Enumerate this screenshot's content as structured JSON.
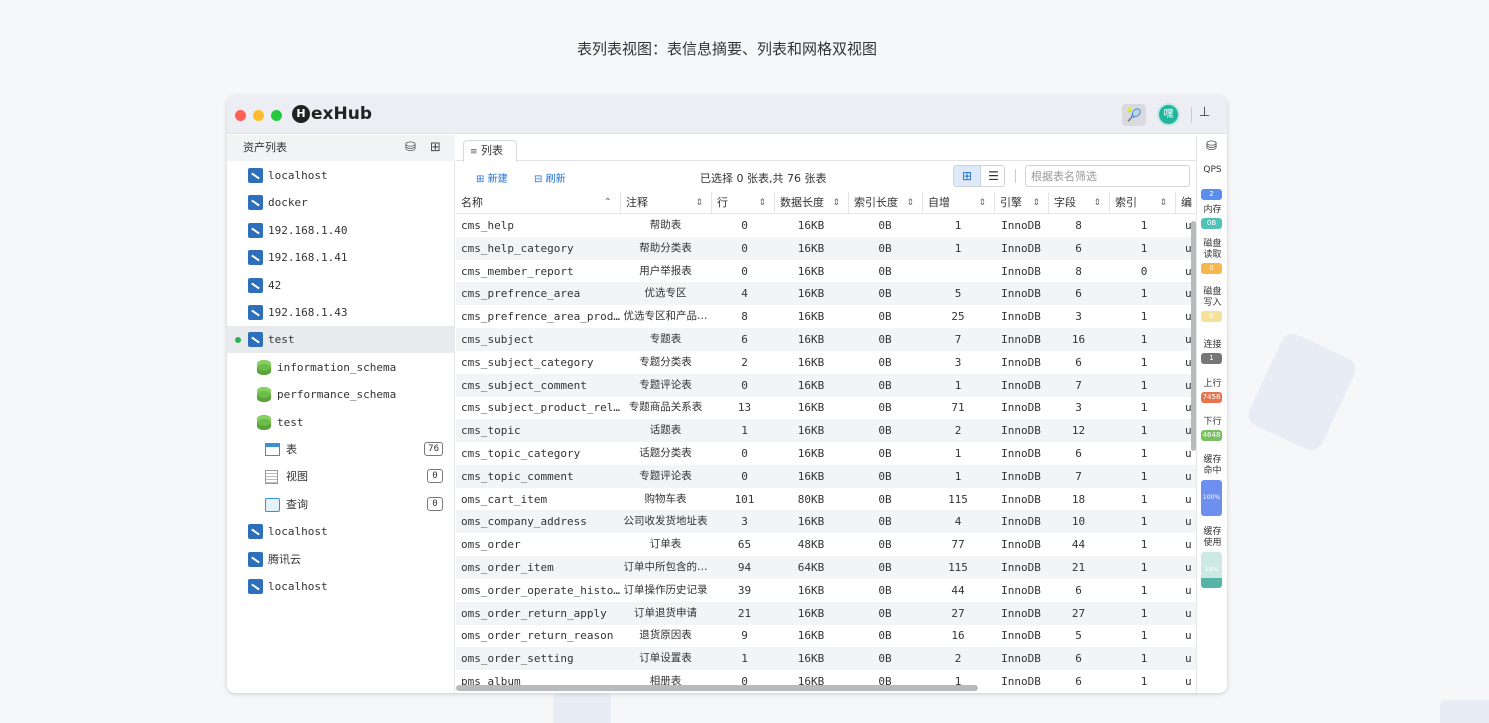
{
  "caption": "表列表视图：表信息摘要、列表和网格双视图",
  "app": {
    "name": "exHub",
    "logo_letter": "H",
    "avatar_text": "嘿",
    "titlebar_icon": "🎾"
  },
  "sidebar": {
    "title": "资产列表",
    "header_icons": [
      "add-db-icon",
      "add-folder-icon"
    ],
    "items": [
      {
        "label": "localhost",
        "type": "server"
      },
      {
        "label": "docker",
        "type": "server"
      },
      {
        "label": "192.168.1.40",
        "type": "server"
      },
      {
        "label": "192.168.1.41",
        "type": "server"
      },
      {
        "label": "42",
        "type": "server"
      },
      {
        "label": "192.168.1.43",
        "type": "server"
      },
      {
        "label": "test",
        "type": "server",
        "active": true,
        "connected": true
      },
      {
        "label": "information_schema",
        "type": "database"
      },
      {
        "label": "performance_schema",
        "type": "database"
      },
      {
        "label": "test",
        "type": "database"
      },
      {
        "label": "表",
        "type": "tables",
        "count": "76"
      },
      {
        "label": "视图",
        "type": "views",
        "count": "0"
      },
      {
        "label": "查询",
        "type": "queries",
        "count": "0"
      },
      {
        "label": "localhost",
        "type": "server"
      },
      {
        "label": "腾讯云",
        "type": "server"
      },
      {
        "label": "localhost",
        "type": "server"
      }
    ]
  },
  "tabs": [
    {
      "label": "列表",
      "icon": "list-icon"
    }
  ],
  "toolbar": {
    "new_label": "新建",
    "refresh_label": "刷新",
    "selection_info": "已选择 0 张表,共 76 张表",
    "filter_placeholder": "根据表名筛选",
    "view_mode": "grid"
  },
  "table": {
    "columns": [
      "名称",
      "注释",
      "行",
      "数据长度",
      "索引长度",
      "自增",
      "引擎",
      "字段",
      "索引",
      "编"
    ],
    "rows": [
      [
        "cms_help",
        "帮助表",
        "0",
        "16KB",
        "0B",
        "1",
        "InnoDB",
        "8",
        "1",
        "u"
      ],
      [
        "cms_help_category",
        "帮助分类表",
        "0",
        "16KB",
        "0B",
        "1",
        "InnoDB",
        "6",
        "1",
        "u"
      ],
      [
        "cms_member_report",
        "用户举报表",
        "0",
        "16KB",
        "0B",
        "",
        "InnoDB",
        "8",
        "0",
        "u"
      ],
      [
        "cms_prefrence_area",
        "优选专区",
        "4",
        "16KB",
        "0B",
        "5",
        "InnoDB",
        "6",
        "1",
        "u"
      ],
      [
        "cms_prefrence_area_prod…",
        "优选专区和产品…",
        "8",
        "16KB",
        "0B",
        "25",
        "InnoDB",
        "3",
        "1",
        "u"
      ],
      [
        "cms_subject",
        "专题表",
        "6",
        "16KB",
        "0B",
        "7",
        "InnoDB",
        "16",
        "1",
        "u"
      ],
      [
        "cms_subject_category",
        "专题分类表",
        "2",
        "16KB",
        "0B",
        "3",
        "InnoDB",
        "6",
        "1",
        "u"
      ],
      [
        "cms_subject_comment",
        "专题评论表",
        "0",
        "16KB",
        "0B",
        "1",
        "InnoDB",
        "7",
        "1",
        "u"
      ],
      [
        "cms_subject_product_rel…",
        "专题商品关系表",
        "13",
        "16KB",
        "0B",
        "71",
        "InnoDB",
        "3",
        "1",
        "u"
      ],
      [
        "cms_topic",
        "话题表",
        "1",
        "16KB",
        "0B",
        "2",
        "InnoDB",
        "12",
        "1",
        "u"
      ],
      [
        "cms_topic_category",
        "话题分类表",
        "0",
        "16KB",
        "0B",
        "1",
        "InnoDB",
        "6",
        "1",
        "u"
      ],
      [
        "cms_topic_comment",
        "专题评论表",
        "0",
        "16KB",
        "0B",
        "1",
        "InnoDB",
        "7",
        "1",
        "u"
      ],
      [
        "oms_cart_item",
        "购物车表",
        "101",
        "80KB",
        "0B",
        "115",
        "InnoDB",
        "18",
        "1",
        "u"
      ],
      [
        "oms_company_address",
        "公司收发货地址表",
        "3",
        "16KB",
        "0B",
        "4",
        "InnoDB",
        "10",
        "1",
        "u"
      ],
      [
        "oms_order",
        "订单表",
        "65",
        "48KB",
        "0B",
        "77",
        "InnoDB",
        "44",
        "1",
        "u"
      ],
      [
        "oms_order_item",
        "订单中所包含的…",
        "94",
        "64KB",
        "0B",
        "115",
        "InnoDB",
        "21",
        "1",
        "u"
      ],
      [
        "oms_order_operate_histo…",
        "订单操作历史记录",
        "39",
        "16KB",
        "0B",
        "44",
        "InnoDB",
        "6",
        "1",
        "u"
      ],
      [
        "oms_order_return_apply",
        "订单退货申请",
        "21",
        "16KB",
        "0B",
        "27",
        "InnoDB",
        "27",
        "1",
        "u"
      ],
      [
        "oms_order_return_reason",
        "退货原因表",
        "9",
        "16KB",
        "0B",
        "16",
        "InnoDB",
        "5",
        "1",
        "u"
      ],
      [
        "oms_order_setting",
        "订单设置表",
        "1",
        "16KB",
        "0B",
        "2",
        "InnoDB",
        "6",
        "1",
        "u"
      ],
      [
        "pms_album",
        "相册表",
        "0",
        "16KB",
        "0B",
        "1",
        "InnoDB",
        "6",
        "1",
        "u"
      ]
    ]
  },
  "metrics": [
    {
      "label": "QPS",
      "value": "2",
      "color": "#5b8def"
    },
    {
      "label": "内存",
      "value": "0B",
      "color": "#4fc3b5"
    },
    {
      "label": "磁盘读取",
      "value": "0",
      "color": "#f5b74e"
    },
    {
      "label": "磁盘写入",
      "value": "0",
      "color": "#f7e09a"
    },
    {
      "label": "连接",
      "value": "1",
      "color": "#777777"
    },
    {
      "label": "上行",
      "value": "7458",
      "color": "#e8734f"
    },
    {
      "label": "下行",
      "value": "4648",
      "color": "#79c15e"
    },
    {
      "label": "缓存命中",
      "value": "100%",
      "color": "#6c8ff0"
    },
    {
      "label": "缓存使用",
      "value": "28%",
      "color": "#57b5a8"
    }
  ]
}
